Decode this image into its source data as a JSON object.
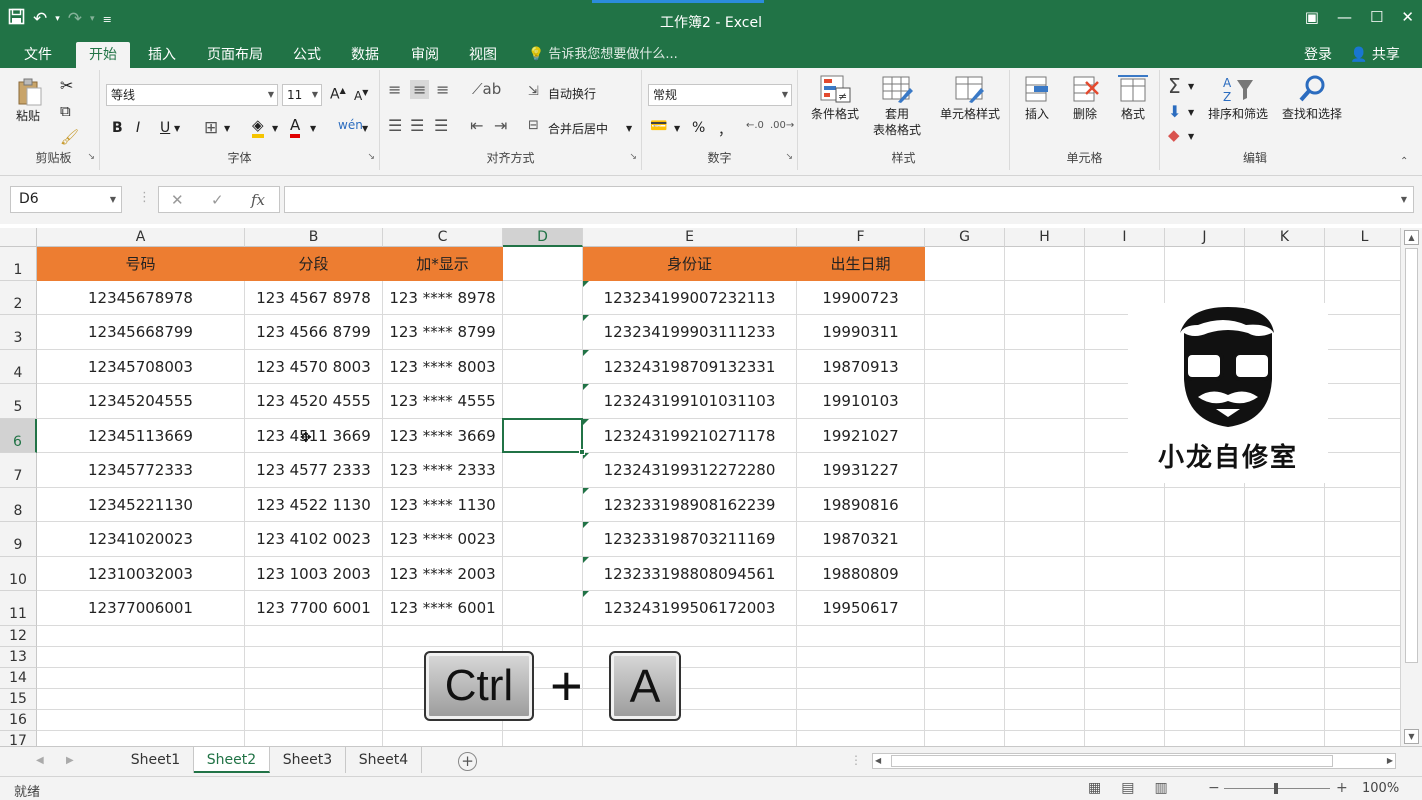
{
  "window": {
    "title": "工作簿2 - Excel",
    "qat_redo_symbol": "↷"
  },
  "ribbon_tabs": {
    "file": "文件",
    "home": "开始",
    "insert": "插入",
    "page_layout": "页面布局",
    "formulas": "公式",
    "data": "数据",
    "review": "审阅",
    "view": "视图",
    "tell_me": "告诉我您想要做什么...",
    "signin": "登录",
    "share": "共享"
  },
  "ribbon": {
    "clipboard": {
      "paste": "粘贴",
      "label": "剪贴板"
    },
    "font": {
      "family": "等线",
      "size": "11",
      "bold": "B",
      "italic": "I",
      "underline": "U",
      "label": "字体"
    },
    "alignment": {
      "wrap": "自动换行",
      "merge": "合并后居中",
      "label": "对齐方式"
    },
    "number": {
      "format": "常规",
      "percent": "%",
      "comma": "，",
      "label": "数字"
    },
    "styles": {
      "conditional": "条件格式",
      "table_line1": "套用",
      "table_line2": "表格格式",
      "cell_styles": "单元格样式",
      "label": "样式"
    },
    "cells": {
      "insert": "插入",
      "delete": "删除",
      "format": "格式",
      "label": "单元格"
    },
    "editing": {
      "sort": "排序和筛选",
      "find": "查找和选择",
      "label": "编辑"
    }
  },
  "formula_bar": {
    "name_box": "D6",
    "fx": "fx",
    "value": ""
  },
  "accent_color": "#217346",
  "header_fill": "#ed7d31",
  "columns": [
    "A",
    "B",
    "C",
    "D",
    "E",
    "F",
    "G",
    "H",
    "I",
    "J",
    "K",
    "L"
  ],
  "rows": [
    "1",
    "2",
    "3",
    "4",
    "5",
    "6",
    "7",
    "8",
    "9",
    "10",
    "11",
    "12",
    "13",
    "14",
    "15",
    "16",
    "17"
  ],
  "sheet": {
    "headers": {
      "A": "号码",
      "B": "分段",
      "C": "加*显示",
      "E": "身份证",
      "F": "出生日期"
    },
    "data": [
      {
        "A": "12345678978",
        "B": "123 4567 8978",
        "C": "123 **** 8978",
        "E": "123234199007232113",
        "F": "19900723"
      },
      {
        "A": "12345668799",
        "B": "123 4566 8799",
        "C": "123 **** 8799",
        "E": "123234199903111233",
        "F": "19990311"
      },
      {
        "A": "12345708003",
        "B": "123 4570 8003",
        "C": "123 **** 8003",
        "E": "123243198709132331",
        "F": "19870913"
      },
      {
        "A": "12345204555",
        "B": "123 4520 4555",
        "C": "123 **** 4555",
        "E": "123243199101031103",
        "F": "19910103"
      },
      {
        "A": "12345113669",
        "B": "123 4511 3669",
        "C": "123 **** 3669",
        "E": "123243199210271178",
        "F": "19921027"
      },
      {
        "A": "12345772333",
        "B": "123 4577 2333",
        "C": "123 **** 2333",
        "E": "123243199312272280",
        "F": "19931227"
      },
      {
        "A": "12345221130",
        "B": "123 4522 1130",
        "C": "123 **** 1130",
        "E": "123233198908162239",
        "F": "19890816"
      },
      {
        "A": "12341020023",
        "B": "123 4102 0023",
        "C": "123 **** 0023",
        "E": "123233198703211169",
        "F": "19870321"
      },
      {
        "A": "12310032003",
        "B": "123 1003 2003",
        "C": "123 **** 2003",
        "E": "123233198808094561",
        "F": "19880809"
      },
      {
        "A": "12377006001",
        "B": "123 7700 6001",
        "C": "123 **** 6001",
        "E": "123243199506172003",
        "F": "19950617"
      }
    ]
  },
  "selected_cell": "D6",
  "logo": {
    "text": "小龙自修室"
  },
  "shortcut": {
    "key1": "Ctrl",
    "plus": "+",
    "key2": "A"
  },
  "sheets": [
    "Sheet1",
    "Sheet2",
    "Sheet3",
    "Sheet4"
  ],
  "active_sheet": "Sheet2",
  "status": {
    "ready": "就绪",
    "zoom": "100%",
    "zoom_minus": "−",
    "zoom_plus": "+"
  }
}
